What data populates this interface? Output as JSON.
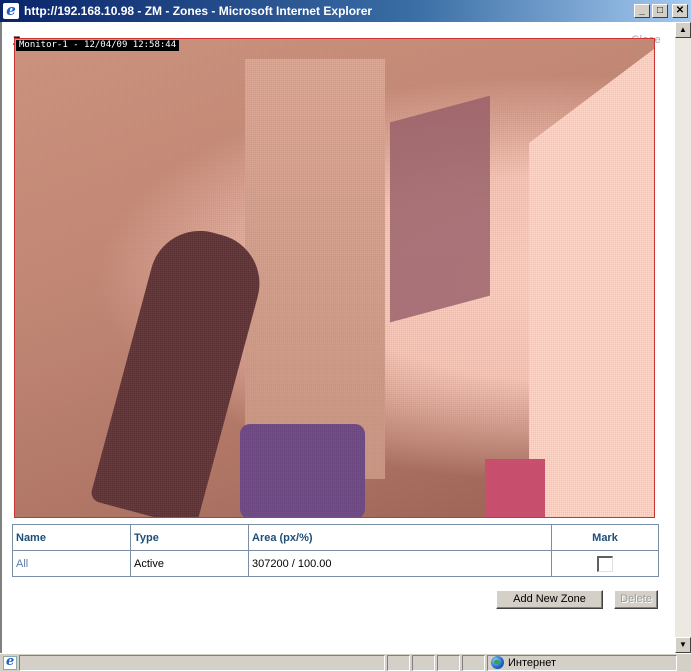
{
  "window": {
    "title": "http://192.168.10.98 - ZM - Zones - Microsoft Internet Explorer",
    "minimize": "_",
    "maximize": "□",
    "close": "✕"
  },
  "page": {
    "title": "Zones",
    "close_link": "Close"
  },
  "camera": {
    "timestamp": "Monitor-1 - 12/04/09 12:58:44"
  },
  "zones_table": {
    "headers": {
      "name": "Name",
      "type": "Type",
      "area": "Area (px/%)",
      "mark": "Mark"
    },
    "rows": [
      {
        "name": "All",
        "type": "Active",
        "area": "307200 / 100.00",
        "mark_checked": false
      }
    ]
  },
  "buttons": {
    "add_new_zone": "Add New Zone",
    "delete": "Delete"
  },
  "statusbar": {
    "zone_label": "Интернет"
  },
  "icons": {
    "app": "ie-icon",
    "status": "ie-icon",
    "zone": "globe-icon"
  },
  "colors": {
    "titlebar_start": "#0a246a",
    "header_text": "#1f4e79",
    "link_text": "#5a7aa6",
    "camera_border": "#cc3333"
  }
}
